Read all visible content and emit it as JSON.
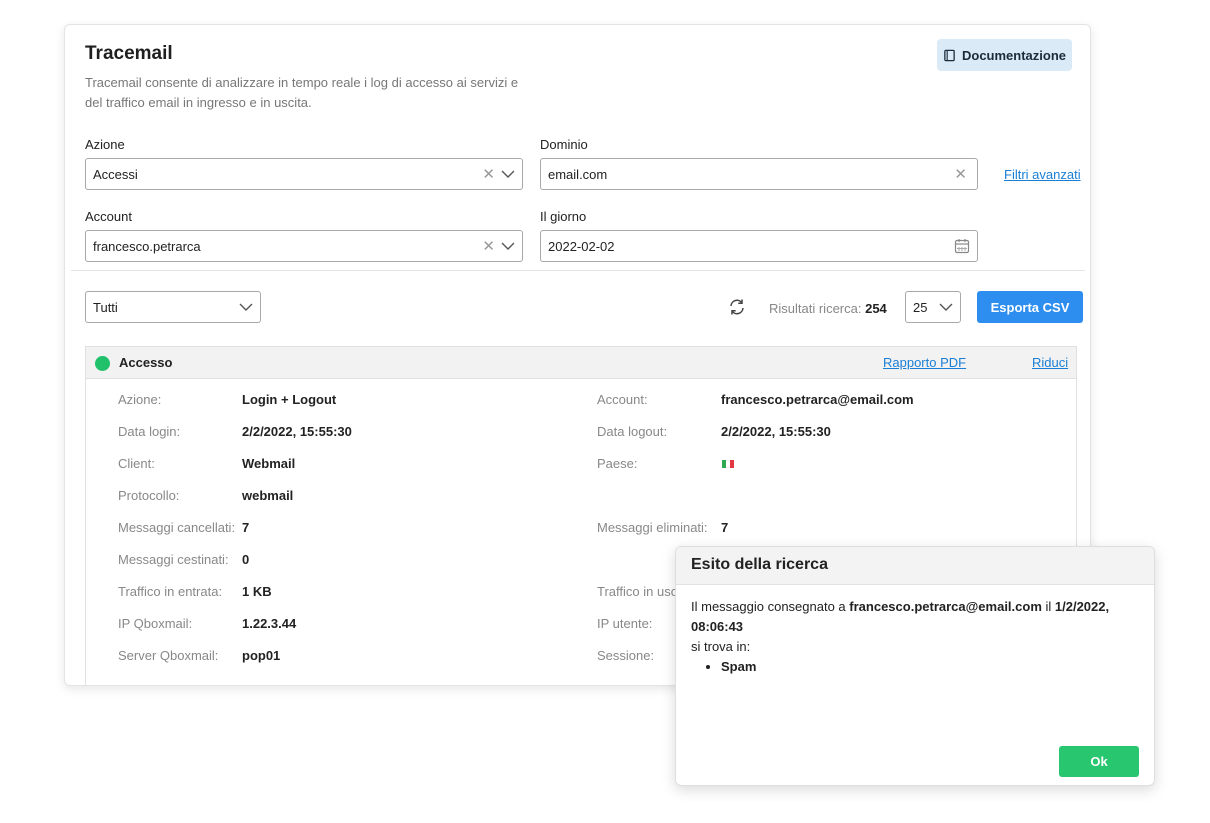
{
  "header": {
    "title": "Tracemail",
    "description": "Tracemail consente di analizzare in tempo reale i log di accesso ai servizi e del traffico email in ingresso e in uscita.",
    "doc_button": "Documentazione"
  },
  "filters": {
    "azione_label": "Azione",
    "azione_value": "Accessi",
    "dominio_label": "Dominio",
    "dominio_value": "email.com",
    "account_label": "Account",
    "account_value": "francesco.petrarca",
    "giorno_label": "Il giorno",
    "giorno_value": "2022-02-02",
    "advanced_link": "Filtri avanzati"
  },
  "toolbar": {
    "status_select": "Tutti",
    "results_label": "Risultati ricerca:",
    "results_count": "254",
    "per_page": "25",
    "export_button": "Esporta CSV"
  },
  "record": {
    "title": "Accesso",
    "status_color": "#21c06b",
    "pdf_link": "Rapporto PDF",
    "collapse_link": "Riduci",
    "left": [
      {
        "k": "Azione:",
        "v": "Login + Logout"
      },
      {
        "k": "Data login:",
        "v": "2/2/2022, 15:55:30"
      },
      {
        "k": "Client:",
        "v": "Webmail"
      },
      {
        "k": "Protocollo:",
        "v": "webmail"
      },
      {
        "k": "Messaggi cancellati:",
        "v": "7"
      },
      {
        "k": "Messaggi cestinati:",
        "v": "0"
      },
      {
        "k": "Traffico in entrata:",
        "v": "1 KB"
      },
      {
        "k": "IP Qboxmail:",
        "v": "1.22.3.44"
      },
      {
        "k": "Server Qboxmail:",
        "v": "pop01"
      }
    ],
    "right": [
      {
        "k": "Account:",
        "v": "francesco.petrarca@email.com"
      },
      {
        "k": "Data logout:",
        "v": "2/2/2022, 15:55:30"
      },
      {
        "k": "Paese:",
        "v": ""
      },
      {
        "k": "Messaggi eliminati:",
        "v": "7"
      },
      {
        "k": "Traffico in uscita:",
        "v": ""
      },
      {
        "k": "IP utente:",
        "v": ""
      },
      {
        "k": "Sessione:",
        "v": ""
      }
    ]
  },
  "modal": {
    "title": "Esito della ricerca",
    "text_1": "Il messaggio consegnato a ",
    "email": "francesco.petrarca@email.com",
    "text_2": " il ",
    "datetime": "1/2/2022, 08:06:43",
    "text_3": "si trova in:",
    "folder": "Spam",
    "ok_button": "Ok"
  },
  "colors": {
    "accent": "#2d8ef0",
    "success": "#28c76f",
    "link": "#1a7fd4"
  }
}
